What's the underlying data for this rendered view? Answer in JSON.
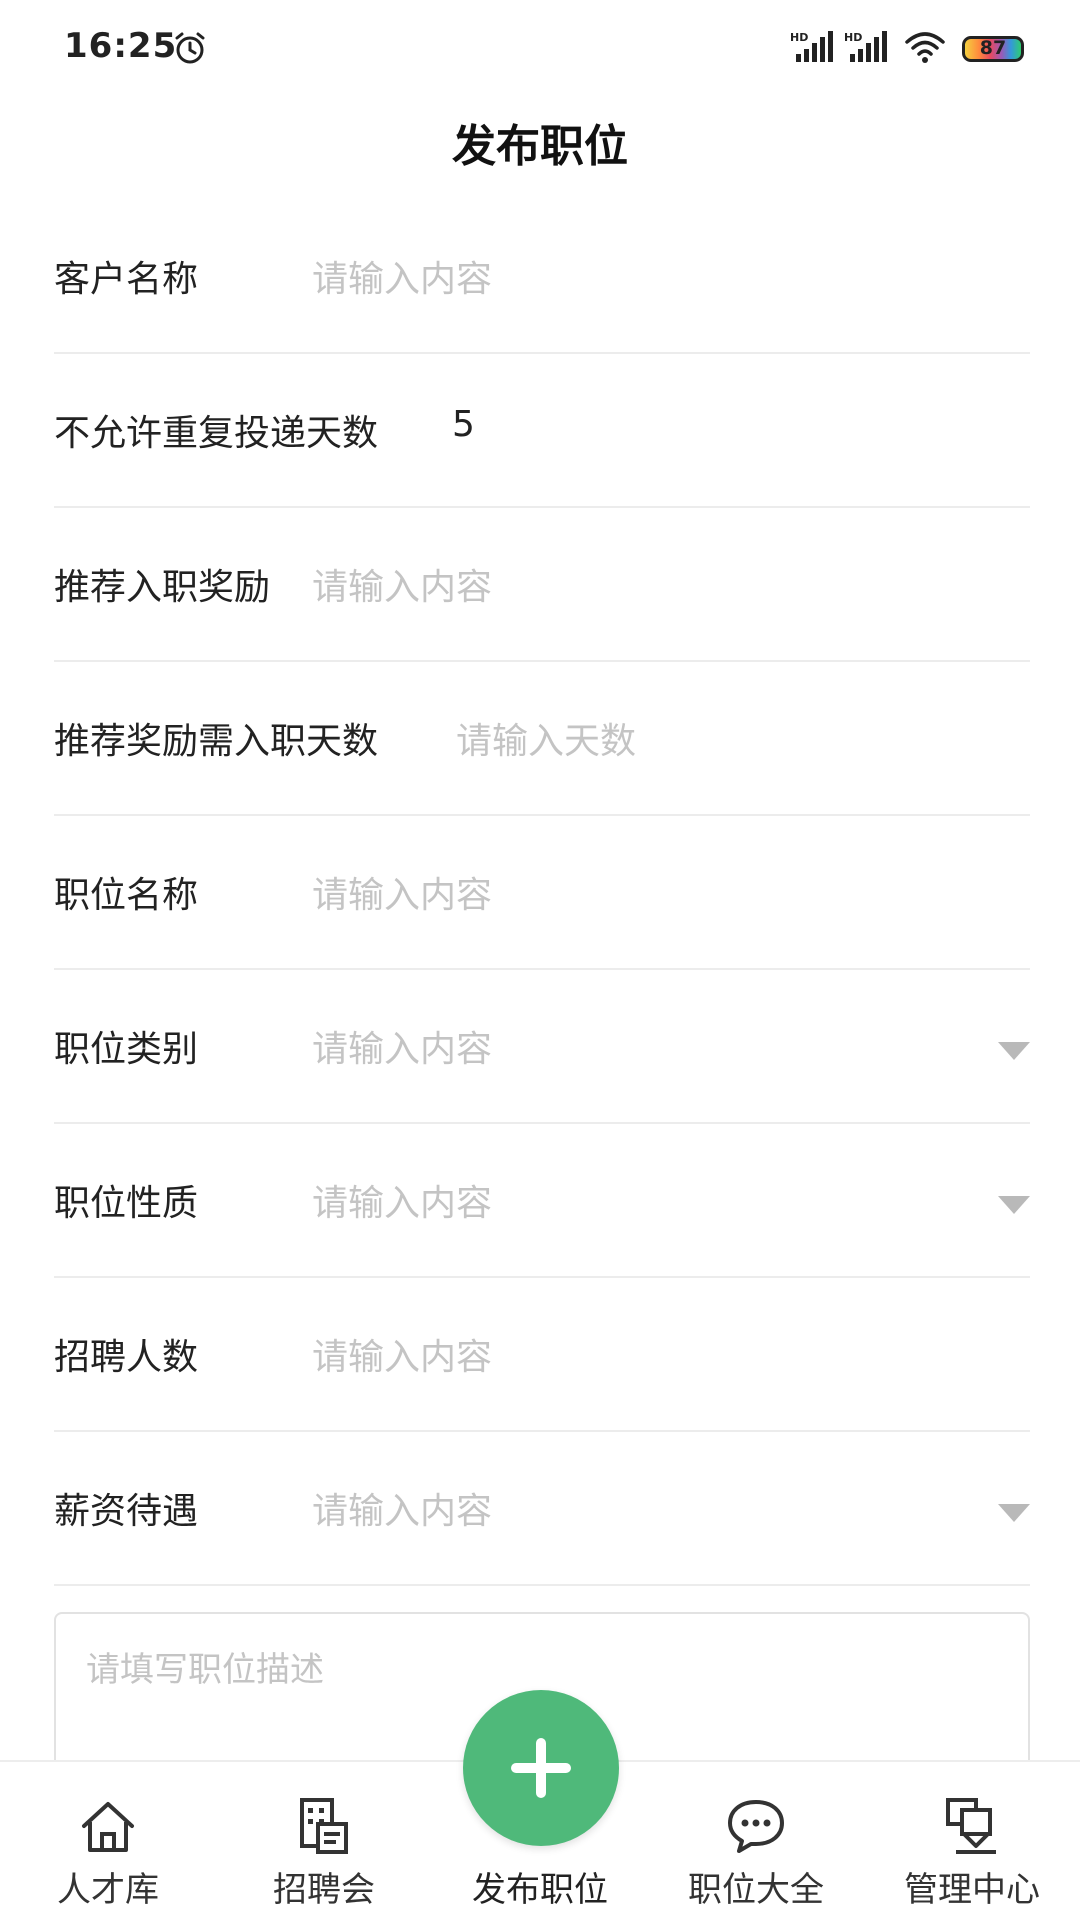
{
  "status_bar": {
    "time": "16:25",
    "battery": "87",
    "signal_badge": "HD",
    "icons": [
      "alarm-icon",
      "signal-icon",
      "signal-icon",
      "wifi-icon",
      "battery-icon"
    ]
  },
  "header": {
    "title": "发布职位"
  },
  "form": {
    "customer_name": {
      "label": "客户名称",
      "placeholder": "请输入内容"
    },
    "no_repeat_days": {
      "label": "不允许重复投递天数",
      "value": "5"
    },
    "referral_reward": {
      "label": "推荐入职奖励",
      "placeholder": "请输入内容"
    },
    "reward_days": {
      "label": "推荐奖励需入职天数",
      "placeholder": "请输入天数"
    },
    "position_name": {
      "label": "职位名称",
      "placeholder": "请输入内容"
    },
    "position_category": {
      "label": "职位类别",
      "placeholder": "请输入内容",
      "icon": "dropdown-arrow-icon"
    },
    "position_nature": {
      "label": "职位性质",
      "placeholder": "请输入内容",
      "icon": "dropdown-arrow-icon"
    },
    "headcount": {
      "label": "招聘人数",
      "placeholder": "请输入内容"
    },
    "salary": {
      "label": "薪资待遇",
      "placeholder": "请输入内容",
      "icon": "dropdown-arrow-icon"
    },
    "description": {
      "placeholder": "请填写职位描述"
    }
  },
  "bottom_nav": {
    "items": [
      {
        "label": "人才库",
        "icon": "home-icon"
      },
      {
        "label": "招聘会",
        "icon": "building-document-icon"
      },
      {
        "label": "发布职位",
        "icon": "plus-icon"
      },
      {
        "label": "职位大全",
        "icon": "chat-bubble-icon"
      },
      {
        "label": "管理中心",
        "icon": "management-icon"
      }
    ]
  },
  "colors": {
    "accent_green": "#4fb97a",
    "placeholder": "#c4c4c4",
    "divider": "#ececec",
    "text": "#222222"
  }
}
